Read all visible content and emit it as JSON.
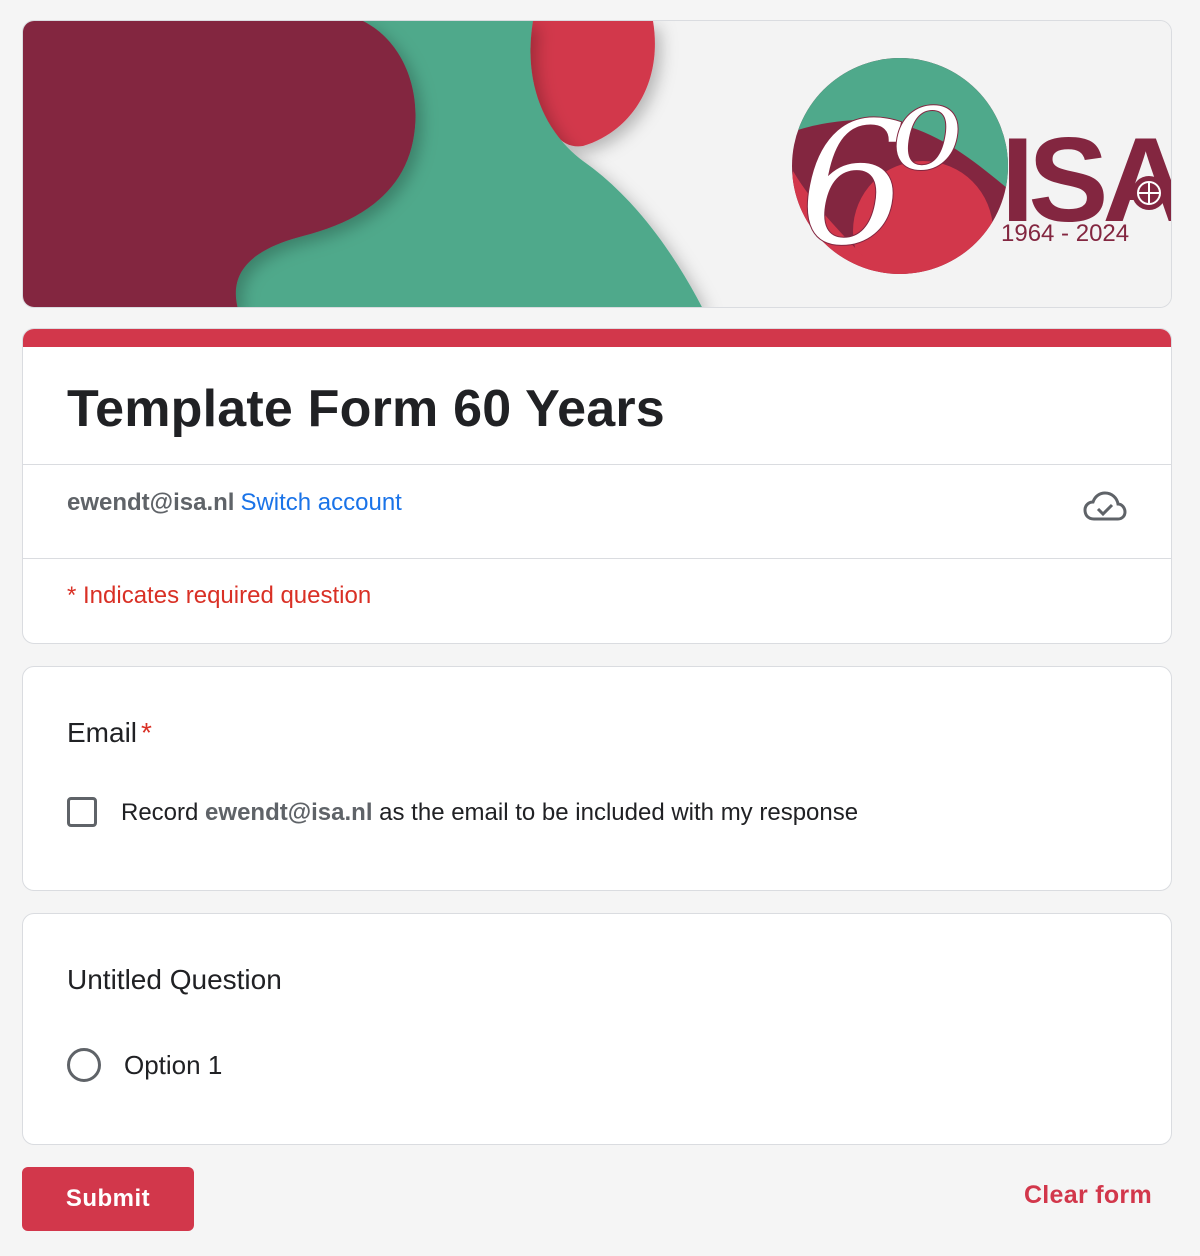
{
  "header": {
    "logo_text": "ISA",
    "logo_number": "60",
    "logo_years": "1964 - 2024"
  },
  "form": {
    "title": "Template Form 60 Years",
    "account_email": "ewendt@isa.nl",
    "switch_account": "Switch account",
    "required_note": "* Indicates required question"
  },
  "questions": [
    {
      "title": "Email",
      "required_marker": "*",
      "checkbox_prefix": "Record",
      "checkbox_email": "ewendt@isa.nl",
      "checkbox_suffix": "as the email to be included with my response",
      "checked": false
    },
    {
      "title": "Untitled Question",
      "option": "Option 1",
      "selected": false
    }
  ],
  "footer": {
    "submit_label": "Submit",
    "clear_label": "Clear form"
  },
  "colors": {
    "accent": "#d2374b",
    "maroon": "#832640",
    "green": "#4fa98b",
    "link": "#1a73e8"
  },
  "icons": {
    "cloud": "cloud-done-icon"
  }
}
